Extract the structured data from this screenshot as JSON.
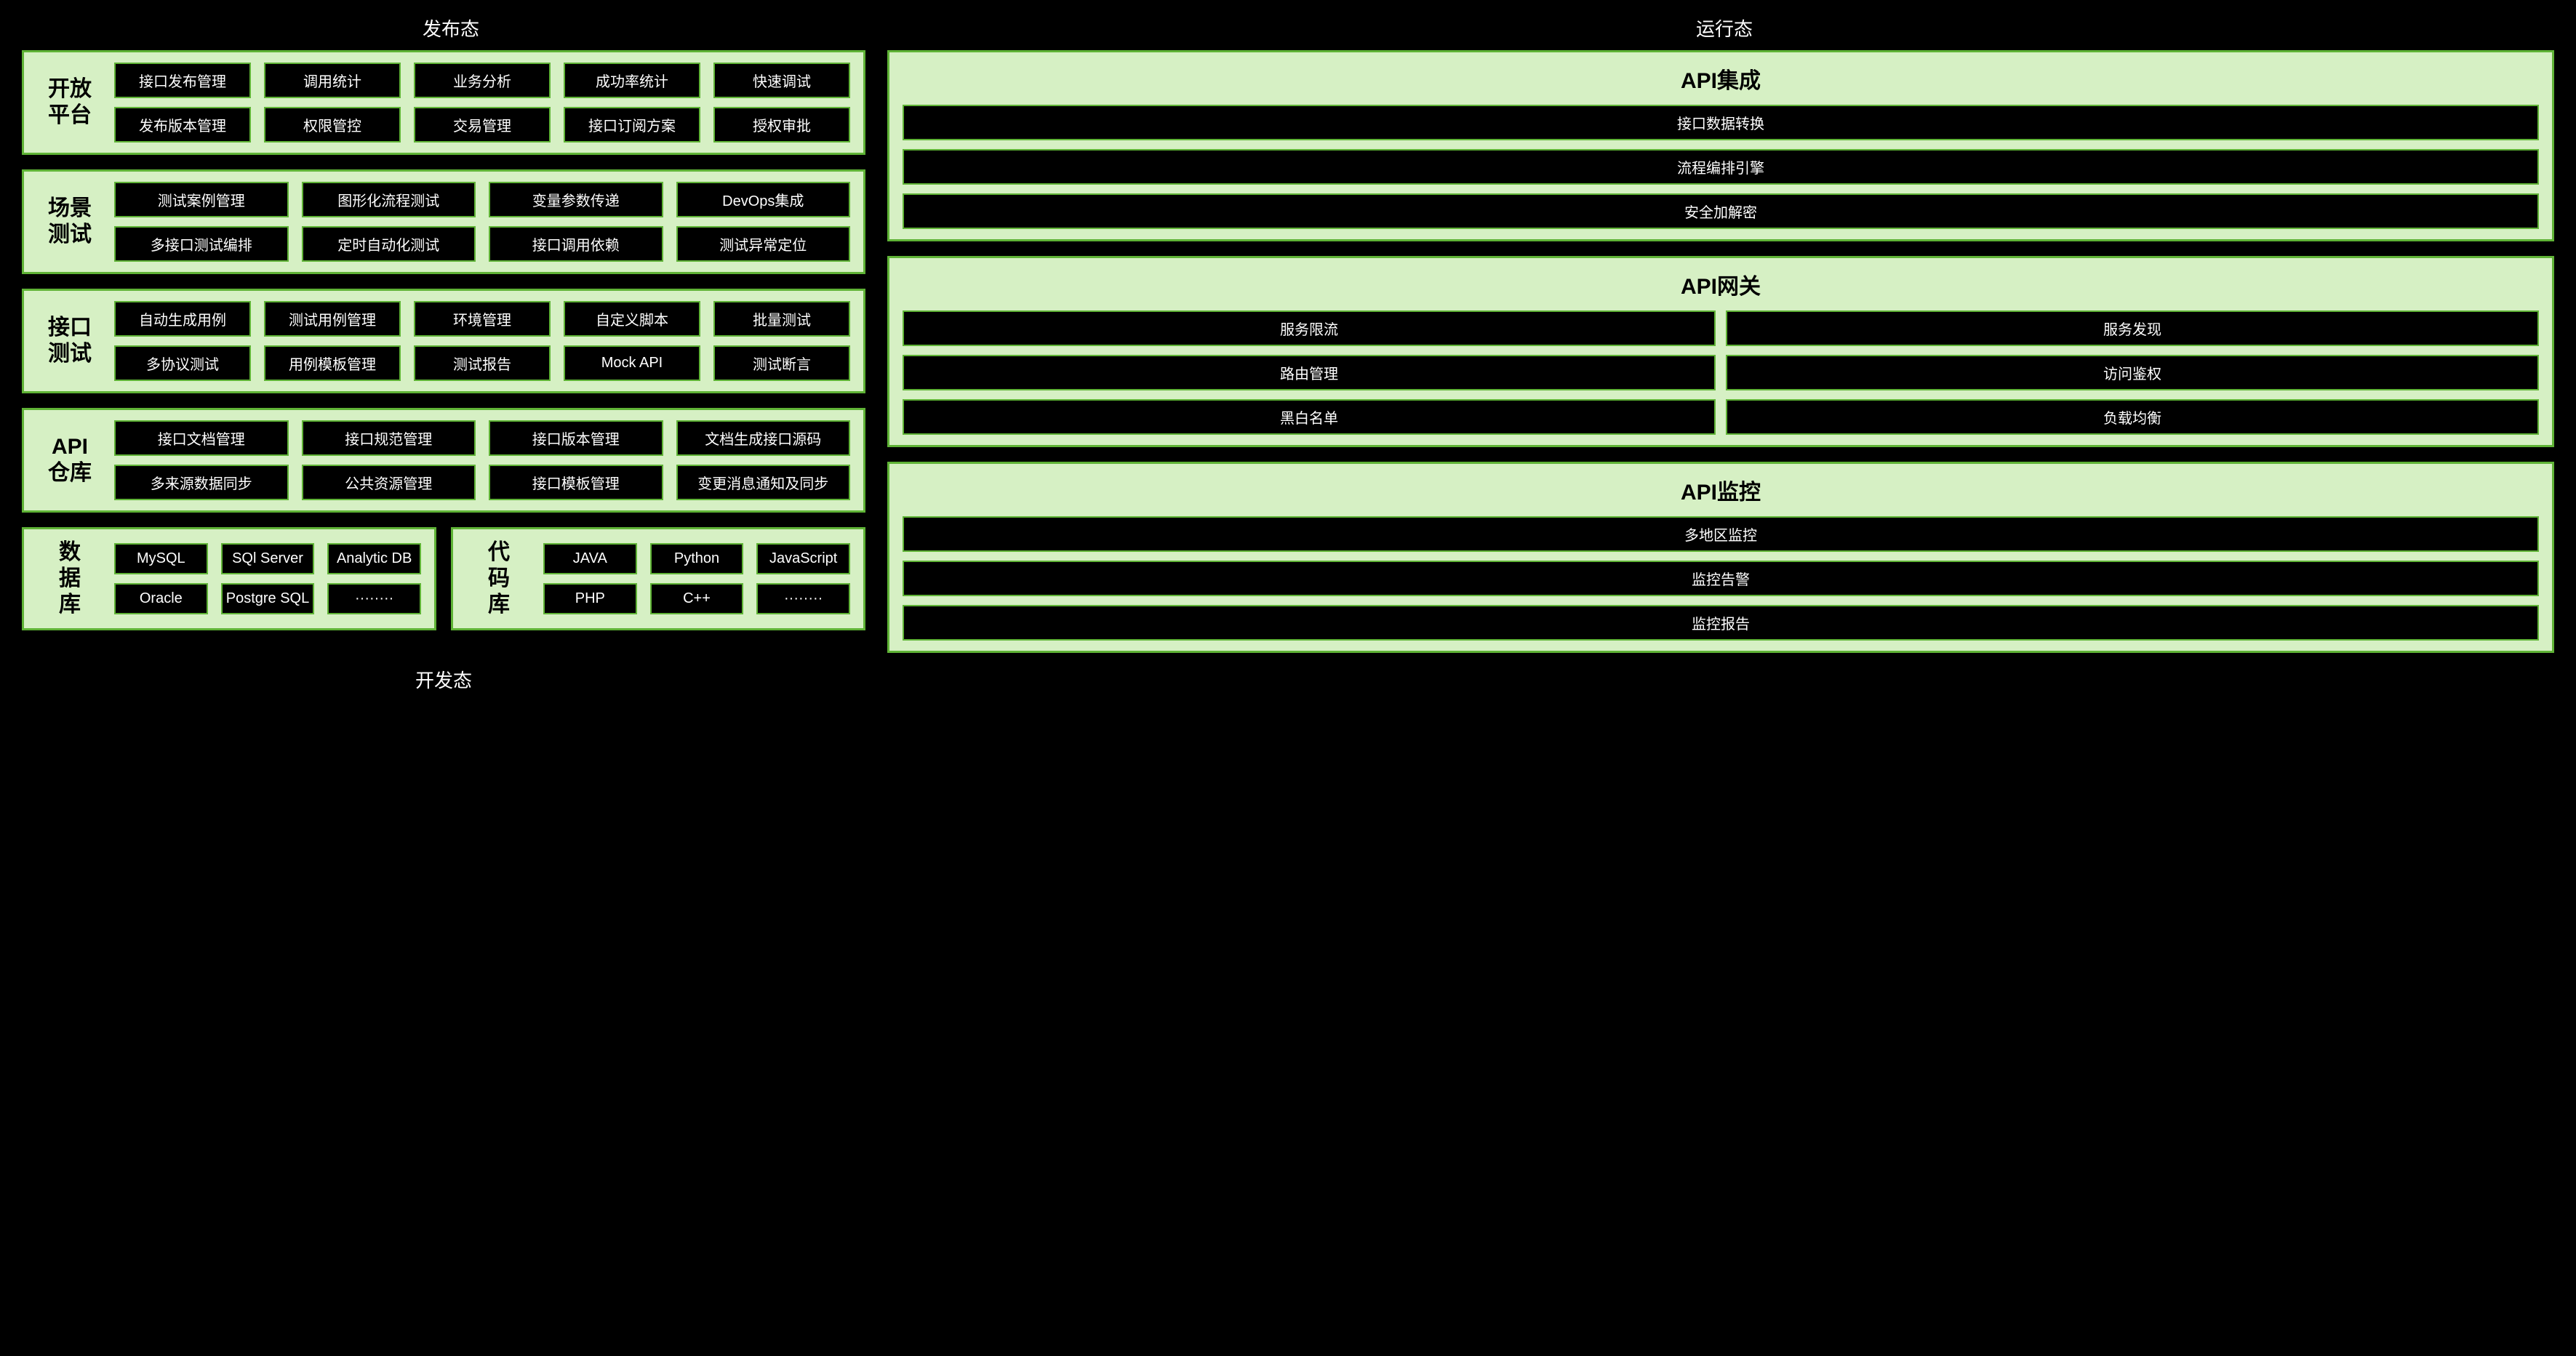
{
  "labels": {
    "publish_state": "发布态",
    "runtime_state": "运行态",
    "develop_state": "开发态"
  },
  "left": {
    "open_platform": {
      "title": "开放平台",
      "title_chars": [
        "开放",
        "平台"
      ],
      "items": [
        "接口发布管理",
        "调用统计",
        "业务分析",
        "成功率统计",
        "快速调试",
        "发布版本管理",
        "权限管控",
        "交易管理",
        "接口订阅方案",
        "授权审批"
      ]
    },
    "scenario_test": {
      "title": "场景测试",
      "title_chars": [
        "场景",
        "测试"
      ],
      "items": [
        "测试案例管理",
        "图形化流程测试",
        "变量参数传递",
        "DevOps集成",
        "多接口测试编排",
        "定时自动化测试",
        "接口调用依赖",
        "测试异常定位"
      ]
    },
    "interface_test": {
      "title": "接口测试",
      "title_chars": [
        "接口",
        "测试"
      ],
      "items": [
        "自动生成用例",
        "测试用例管理",
        "环境管理",
        "自定义脚本",
        "批量测试",
        "多协议测试",
        "用例模板管理",
        "测试报告",
        "Mock API",
        "测试断言"
      ]
    },
    "api_repo": {
      "title": "API仓库",
      "title_chars": [
        "API",
        "仓库"
      ],
      "items": [
        "接口文档管理",
        "接口规范管理",
        "接口版本管理",
        "文档生成接口源码",
        "多来源数据同步",
        "公共资源管理",
        "接口模板管理",
        "变更消息通知及同步"
      ]
    },
    "database": {
      "title": "数据库",
      "title_chars": [
        "数",
        "据",
        "库"
      ],
      "items": [
        "MySQL",
        "SQl Server",
        "Analytic DB",
        "Oracle",
        "Postgre SQL",
        "········"
      ]
    },
    "code_repo": {
      "title": "代码库",
      "title_chars": [
        "代",
        "码",
        "库"
      ],
      "items": [
        "JAVA",
        "Python",
        "JavaScript",
        "PHP",
        "C++",
        "········"
      ]
    }
  },
  "right": {
    "api_integration": {
      "title": "API集成",
      "items": [
        "接口数据转换",
        "流程编排引擎",
        "安全加解密"
      ]
    },
    "api_gateway": {
      "title": "API网关",
      "items": [
        "服务限流",
        "服务发现",
        "路由管理",
        "访问鉴权",
        "黑白名单",
        "负载均衡"
      ]
    },
    "api_monitor": {
      "title": "API监控",
      "items": [
        "多地区监控",
        "监控告警",
        "监控报告"
      ]
    }
  }
}
